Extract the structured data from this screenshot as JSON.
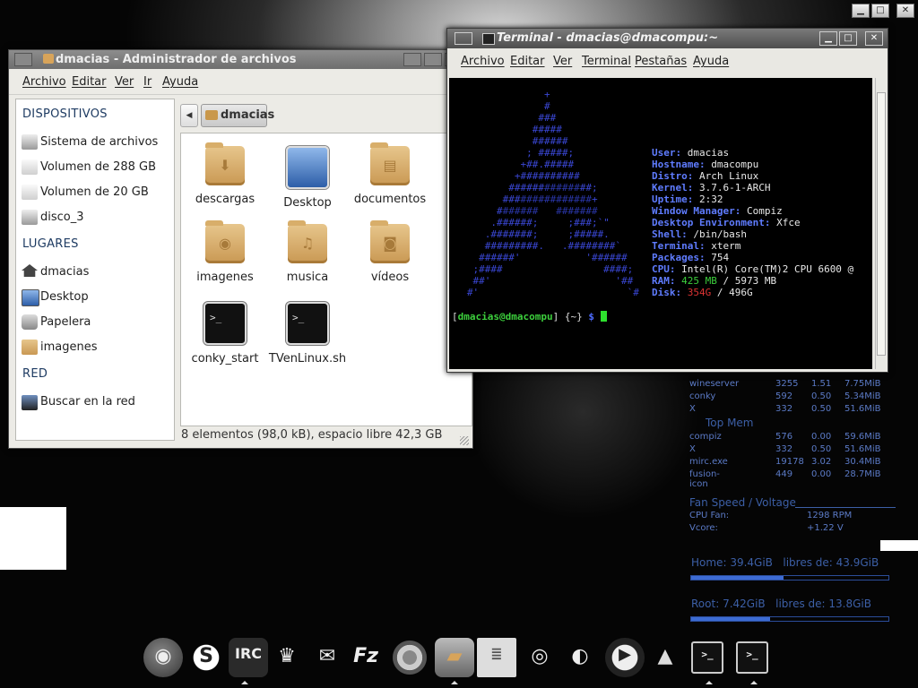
{
  "file_manager": {
    "title": "dmacias - Administrador de archivos",
    "menu": [
      "Archivo",
      "Editar",
      "Ver",
      "Ir",
      "Ayuda"
    ],
    "sidebar": {
      "devices_header": "DISPOSITIVOS",
      "devices": [
        "Sistema de archivos",
        "Volumen de 288 GB",
        "Volumen de 20 GB",
        "disco_3"
      ],
      "places_header": "LUGARES",
      "places": [
        "dmacias",
        "Desktop",
        "Papelera",
        "imagenes"
      ],
      "network_header": "RED",
      "network": [
        "Buscar en la red"
      ]
    },
    "path": "dmacias",
    "files": [
      "descargas",
      "Desktop",
      "documentos",
      "imagenes",
      "musica",
      "videos",
      "conky_start",
      "TVenLinux.sh"
    ],
    "files_display": [
      "descargas",
      "Desktop",
      "documentos",
      "imagenes",
      "musica",
      "vídeos",
      "conky_start",
      "TVenLinux.sh"
    ],
    "status": "8 elementos (98,0 kB), espacio libre 42,3 GB"
  },
  "terminal": {
    "title": "Terminal - dmacias@dmacompu:~",
    "menu": [
      "Archivo",
      "Editar",
      "Ver",
      "Terminal",
      "Pestañas",
      "Ayuda"
    ],
    "info": {
      "user": "dmacias",
      "hostname": "dmacompu",
      "distro": "Arch Linux",
      "kernel": "3.7.6-1-ARCH",
      "uptime": "2:32",
      "window_manager": "Compiz",
      "desktop_environment": "Xfce",
      "shell": "/bin/bash",
      "terminal": "xterm",
      "packages": "754",
      "cpu": "Intel(R) Core(TM)2 CPU 6600 @",
      "ram_used": "425 MB",
      "ram_total": "5973 MB",
      "disk_used": "354G",
      "disk_total": "496G"
    },
    "prompt_user": "dmacias@dmacompu",
    "prompt_dir": "{~}",
    "prompt_symbol": "$"
  },
  "conky": {
    "top_cpu": [
      {
        "name": "wineserver",
        "pid": "3255",
        "pct": "1.51",
        "mem": "7.75MiB"
      },
      {
        "name": "conky",
        "pid": "592",
        "pct": "0.50",
        "mem": "5.34MiB"
      },
      {
        "name": "X",
        "pid": "332",
        "pct": "0.50",
        "mem": "51.6MiB"
      }
    ],
    "top_mem_header": "Top Mem",
    "top_mem": [
      {
        "name": "compiz",
        "pid": "576",
        "pct": "0.00",
        "mem": "59.6MiB"
      },
      {
        "name": "X",
        "pid": "332",
        "pct": "0.50",
        "mem": "51.6MiB"
      },
      {
        "name": "mirc.exe",
        "pid": "19178",
        "pct": "3.02",
        "mem": "30.4MiB"
      },
      {
        "name": "fusion-icon",
        "pid": "449",
        "pct": "0.00",
        "mem": "28.7MiB"
      }
    ],
    "fan_header": "Fan Speed / Voltage",
    "cpu_fan_label": "CPU Fan:",
    "cpu_fan_value": "1298 RPM",
    "vcore_label": "Vcore:",
    "vcore_value": "+1.22 V",
    "home_label": "Home:",
    "home_used": "39.4GiB",
    "home_free_label": "libres de:",
    "home_free": "43.9GiB",
    "home_fraction": 0.47,
    "root_label": "Root:",
    "root_used": "7.42GiB",
    "root_free_label": "libres de:",
    "root_free": "13.8GiB",
    "root_fraction": 0.4
  },
  "dock": [
    "firefox",
    "skype",
    "irc",
    "wine",
    "mail",
    "filezilla",
    "chrome",
    "file-manager",
    "text-editor",
    "blender",
    "screenshot",
    "media-player",
    "vlc",
    "terminal",
    "terminal"
  ],
  "colors": {
    "conky_blue": "#5b7ac6",
    "terminal_green": "#3ccf3c",
    "arch_blue": "#3a47d4"
  }
}
